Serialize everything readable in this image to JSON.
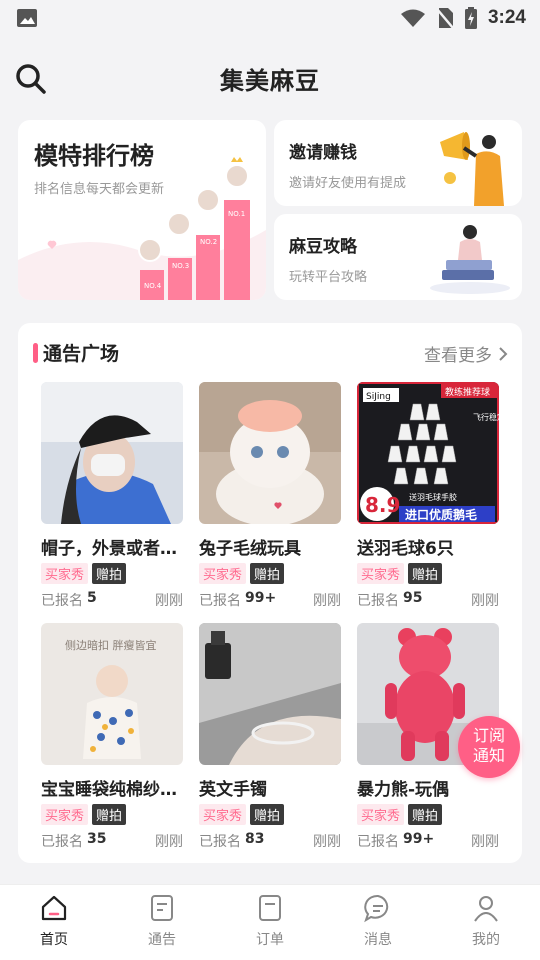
{
  "status_bar": {
    "time": "3:24"
  },
  "header": {
    "title": "集美麻豆"
  },
  "ranking_card": {
    "title": "模特排行榜",
    "subtitle": "排名信息每天都会更新",
    "ranks": [
      "NO.1",
      "NO.2",
      "NO.3",
      "NO.4"
    ]
  },
  "invite_card": {
    "title": "邀请赚钱",
    "subtitle": "邀请好友使用有提成"
  },
  "guide_card": {
    "title": "麻豆攻略",
    "subtitle": "玩转平台攻略"
  },
  "plaza": {
    "title": "通告广场",
    "more_label": "查看更多",
    "items": [
      {
        "title": "帽子，外景或者…",
        "tag1": "买家秀",
        "tag2": "赠拍",
        "signup_label": "已报名",
        "signup_count": "5",
        "time": "刚刚"
      },
      {
        "title": "兔子毛绒玩具",
        "tag1": "买家秀",
        "tag2": "赠拍",
        "signup_label": "已报名",
        "signup_count": "99+",
        "time": "刚刚"
      },
      {
        "title": "送羽毛球6只",
        "tag1": "买家秀",
        "tag2": "赠拍",
        "signup_label": "已报名",
        "signup_count": "95",
        "time": "刚刚",
        "image_text": {
          "brand": "SiJing",
          "badge": "教练推荐球",
          "price": "8.9",
          "banner_top": "送羽毛球手胶",
          "banner": "进口优质鹅毛",
          "side": "飞行稳定"
        }
      },
      {
        "title": "宝宝睡袋纯棉纱…",
        "tag1": "买家秀",
        "tag2": "赠拍",
        "signup_label": "已报名",
        "signup_count": "35",
        "time": "刚刚",
        "image_text": {
          "caption": "侧边暗扣 胖瘦皆宜"
        }
      },
      {
        "title": "英文手镯",
        "tag1": "买家秀",
        "tag2": "赠拍",
        "signup_label": "已报名",
        "signup_count": "83",
        "time": "刚刚"
      },
      {
        "title": "暴力熊-玩偶",
        "tag1": "买家秀",
        "tag2": "赠拍",
        "signup_label": "已报名",
        "signup_count": "99+",
        "time": "刚刚"
      }
    ]
  },
  "subscribe_button": {
    "line1": "订阅",
    "line2": "通知"
  },
  "tab_bar": {
    "tabs": [
      {
        "label": "首页",
        "icon": "home-icon",
        "active": true
      },
      {
        "label": "通告",
        "icon": "notice-icon"
      },
      {
        "label": "订单",
        "icon": "order-icon"
      },
      {
        "label": "消息",
        "icon": "message-icon"
      },
      {
        "label": "我的",
        "icon": "profile-icon"
      }
    ]
  },
  "colors": {
    "accent": "#ff5f86",
    "background": "#f3f3f5",
    "tag_pink_bg": "#fde9ee",
    "tag_dark_bg": "#3a3a3a"
  }
}
